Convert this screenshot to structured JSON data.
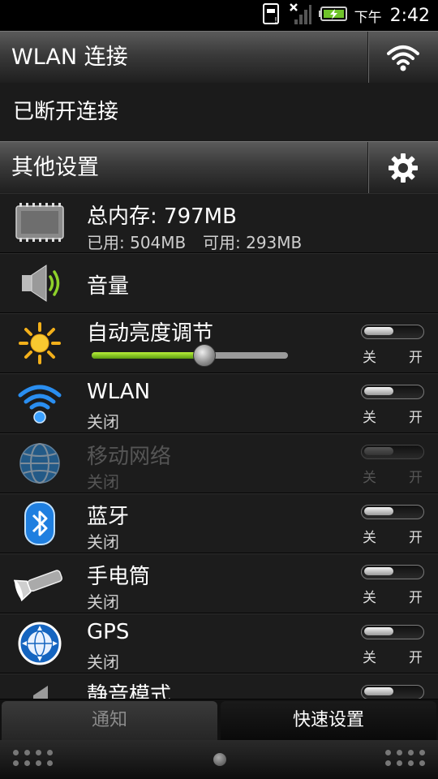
{
  "status_bar": {
    "ampm": "下午",
    "time": "2:42"
  },
  "wlan_header": {
    "title": "WLAN 连接"
  },
  "wlan_status": {
    "text": "已断开连接"
  },
  "other_header": {
    "title": "其他设置"
  },
  "memory": {
    "title": "总内存: 797MB",
    "used": "已用: 504MB",
    "available": "可用: 293MB"
  },
  "volume": {
    "title": "音量"
  },
  "brightness": {
    "title": "自动亮度调节",
    "level_percent": 57
  },
  "toggle_labels": {
    "off": "关",
    "on": "开"
  },
  "items": [
    {
      "title": "WLAN",
      "state": "关闭"
    },
    {
      "title": "移动网络",
      "state": "关闭"
    },
    {
      "title": "蓝牙",
      "state": "关闭"
    },
    {
      "title": "手电筒",
      "state": "关闭"
    },
    {
      "title": "GPS",
      "state": "关闭"
    },
    {
      "title": "静音模式"
    }
  ],
  "tabs": {
    "notify": "通知",
    "quick": "快速设置"
  },
  "colors": {
    "accent_green": "#8ed12a",
    "wlan_blue": "#2a8ef0"
  }
}
